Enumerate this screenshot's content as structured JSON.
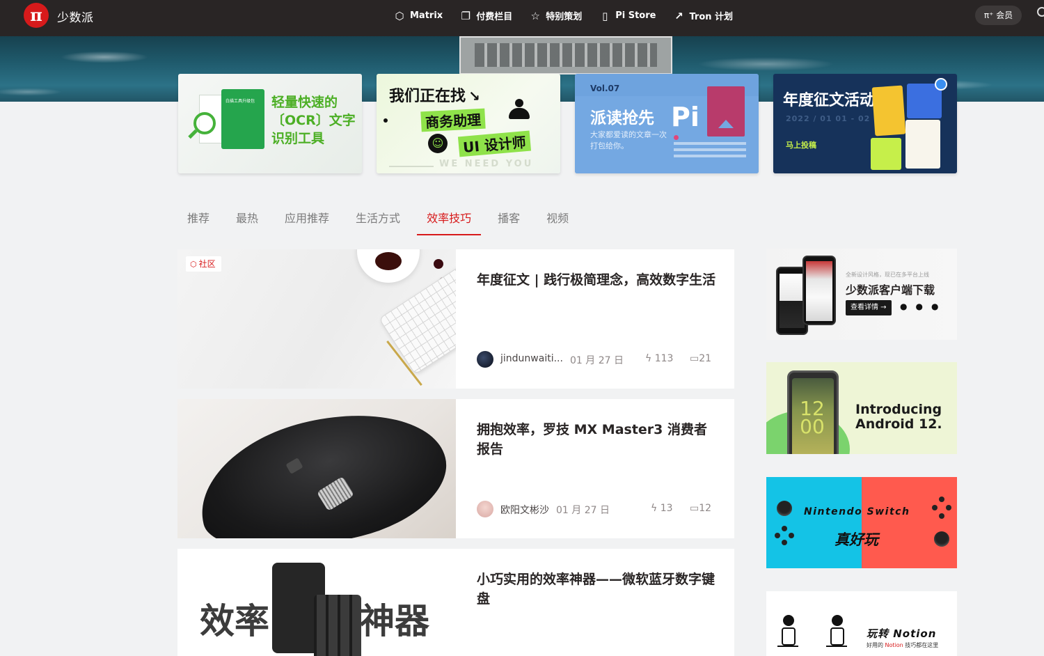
{
  "header": {
    "logo_glyph": "π",
    "brand": "少数派",
    "nav": [
      {
        "label": "Matrix",
        "icon": "matrix-icon",
        "glyph": "⬡"
      },
      {
        "label": "付费栏目",
        "icon": "paid-column-icon",
        "glyph": "❐"
      },
      {
        "label": "特别策划",
        "icon": "star-icon",
        "glyph": "☆"
      },
      {
        "label": "Pi Store",
        "icon": "store-icon",
        "glyph": "▯"
      },
      {
        "label": "Tron 计划",
        "icon": "speed-icon",
        "glyph": "↗"
      }
    ],
    "member_label": "π⁺ 会员"
  },
  "banners": [
    {
      "title_lines": [
        "轻量快速的",
        "〔OCR〕文字",
        "识别工具"
      ],
      "app_label": "白描工具升级包"
    },
    {
      "title": "我们正在找",
      "arrow": "↘",
      "tag1": "商务助理",
      "tag2": "UI 设计师",
      "footer": "WE NEED YOU"
    },
    {
      "vol": "Vol.07",
      "title": "派读抢先",
      "sub": "大家都爱读的文章一次打包给你。",
      "logo": "Pi"
    },
    {
      "title": "年度征文活动",
      "dates": "2022 / 01 01 - 02 28",
      "cta": "马上投稿"
    }
  ],
  "tabs": [
    {
      "label": "推荐",
      "active": false
    },
    {
      "label": "最热",
      "active": false
    },
    {
      "label": "应用推荐",
      "active": false
    },
    {
      "label": "生活方式",
      "active": false
    },
    {
      "label": "效率技巧",
      "active": true
    },
    {
      "label": "播客",
      "active": false
    },
    {
      "label": "视频",
      "active": false
    }
  ],
  "articles": [
    {
      "badge": "社区",
      "title": "年度征文 | 践行极简理念，高效数字生活",
      "author": "jindunwaiti...",
      "date": "01 月 27 日",
      "likes": "113",
      "comments": "21"
    },
    {
      "title": "拥抱效率，罗技 MX Master3 消费者报告",
      "author": "欧阳文彬沙",
      "date": "01 月 27 日",
      "likes": "13",
      "comments": "12"
    },
    {
      "title": "小巧实用的效率神器——微软蓝牙数字键盘",
      "thumb_left": "效率",
      "thumb_right": "神器"
    }
  ],
  "sidebar": {
    "ad1": {
      "small": "全新设计风格，现已在多平台上线",
      "title": "少数派客户端下载",
      "button": "查看详情 →",
      "platform_glyphs": "  "
    },
    "ad2": {
      "time": "12\n00",
      "text_line1": "Introducing",
      "text_line2": "Android 12."
    },
    "ad3": {
      "line1": "Nintendo Switch",
      "line2": "真好玩"
    },
    "ad4": {
      "title": "玩转 Notion",
      "sub_prefix": "好用的 ",
      "sub_highlight": "Notion",
      "sub_suffix": " 技巧都在这里"
    }
  },
  "colors": {
    "brand_red": "#d71a1b",
    "nav_bg": "#292525",
    "ocr_green": "#4caf25",
    "lime": "#8fe24a"
  }
}
